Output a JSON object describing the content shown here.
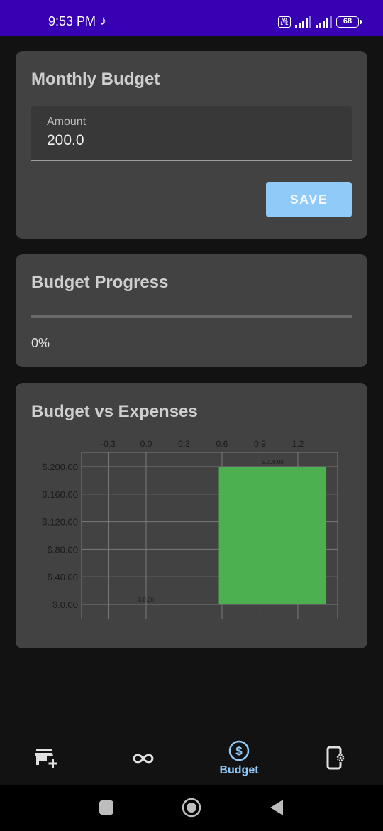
{
  "status_bar": {
    "time": "9:53 PM",
    "volte": "Vo LTE",
    "battery": "68"
  },
  "budget_card": {
    "title": "Monthly Budget",
    "amount_label": "Amount",
    "amount_value": "200.0",
    "save_label": "SAVE"
  },
  "progress_card": {
    "title": "Budget Progress",
    "progress_percent": 0,
    "progress_text": "0%"
  },
  "chart_card": {
    "title": "Budget vs Expenses"
  },
  "chart_data": {
    "type": "bar",
    "title": "",
    "xlabel": "",
    "ylabel": "",
    "x_ticks": [
      "-0.3",
      "0.0",
      "0.3",
      "0.6",
      "0.9",
      "1.2"
    ],
    "y_ticks": [
      "ჽ.0.00",
      "ჽ.40.00",
      "ჽ.80.00",
      "ჽ.120.00",
      "ჽ.160.00",
      "ჽ.200.00"
    ],
    "xlim": [
      -0.5,
      1.5
    ],
    "ylim": [
      0,
      200
    ],
    "bars": [
      {
        "x": 0,
        "value": 0,
        "label": "ჽ.0.00",
        "color": "#4caf50"
      },
      {
        "x": 1,
        "value": 200,
        "label": "ჽ.200.00",
        "color": "#4caf50"
      }
    ],
    "bar_width": 0.85,
    "grid": true
  },
  "bottom_nav": {
    "items": [
      {
        "icon": "store-add-icon",
        "label": ""
      },
      {
        "icon": "infinity-icon",
        "label": ""
      },
      {
        "icon": "dollar-circle-icon",
        "label": "Budget"
      },
      {
        "icon": "phone-settings-icon",
        "label": ""
      }
    ],
    "active_color": "#90caf9",
    "inactive_color": "#e0e0e0"
  },
  "system_nav": {
    "items": [
      "square-recents-icon",
      "circle-home-icon",
      "triangle-back-icon"
    ]
  }
}
